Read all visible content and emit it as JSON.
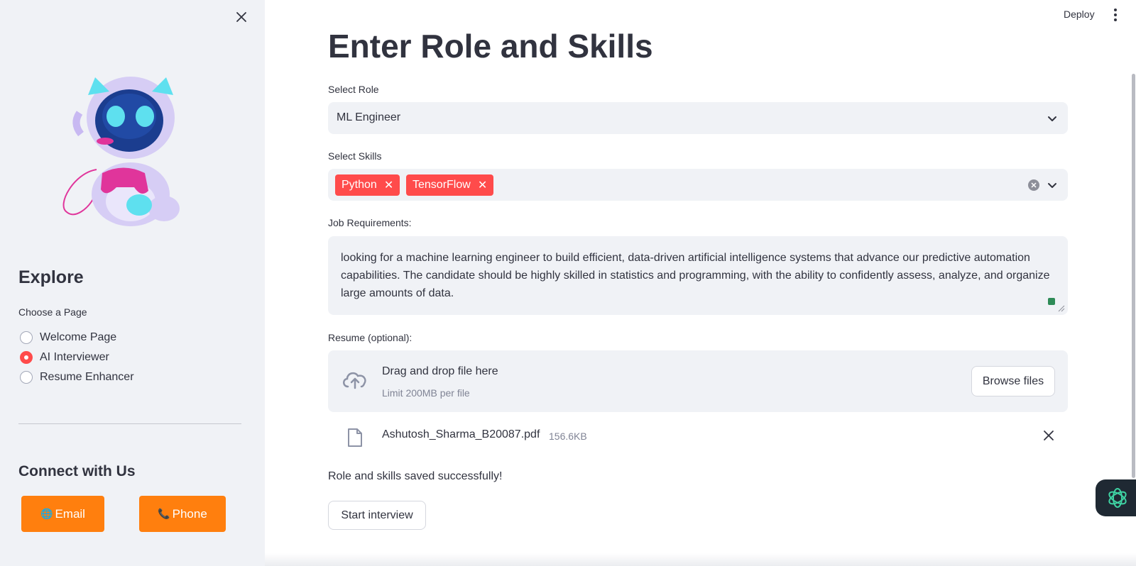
{
  "sidebar": {
    "explore_heading": "Explore",
    "choose_label": "Choose a Page",
    "pages": [
      {
        "label": "Welcome Page",
        "selected": false
      },
      {
        "label": "AI Interviewer",
        "selected": true
      },
      {
        "label": "Resume Enhancer",
        "selected": false
      }
    ],
    "connect_heading": "Connect with Us",
    "email_button": "Email",
    "phone_button": "Phone"
  },
  "header": {
    "deploy_label": "Deploy"
  },
  "main": {
    "title": "Enter Role and Skills",
    "role_label": "Select Role",
    "role_value": "ML Engineer",
    "skills_label": "Select Skills",
    "skills": [
      "Python",
      "TensorFlow"
    ],
    "job_req_label": "Job Requirements:",
    "job_req_text": "looking for a machine learning engineer to build efficient, data-driven artificial intelligence systems that advance our predictive automation capabilities. The candidate should be highly skilled in statistics and programming, with the ability to confidently assess, analyze, and organize large amounts of data.",
    "resume_label": "Resume (optional):",
    "drop_title": "Drag and drop file here",
    "drop_limit": "Limit 200MB per file",
    "browse_button": "Browse files",
    "file_name": "Ashutosh_Sharma_B20087.pdf",
    "file_size": "156.6KB",
    "success_message": "Role and skills saved successfully!",
    "start_button": "Start interview"
  },
  "colors": {
    "accent": "#ff4b4b",
    "orange": "#ff7f0e",
    "sidebar_bg": "#f0f2f6"
  }
}
